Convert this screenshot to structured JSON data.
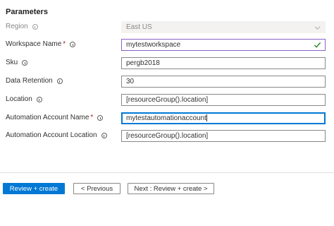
{
  "section": {
    "title": "Parameters"
  },
  "fields": {
    "region": {
      "label": "Region",
      "value": "East US"
    },
    "workspace_name": {
      "label": "Workspace Name",
      "required": "*",
      "value": "mytestworkspace"
    },
    "sku": {
      "label": "Sku",
      "value": "pergb2018"
    },
    "data_retention": {
      "label": "Data Retention",
      "value": "30"
    },
    "location": {
      "label": "Location",
      "value": "[resourceGroup().location]"
    },
    "automation_account_name": {
      "label": "Automation Account Name",
      "required": "*",
      "value": "mytestautomationaccount"
    },
    "automation_account_location": {
      "label": "Automation Account Location",
      "value": "[resourceGroup().location]"
    }
  },
  "buttons": {
    "review_create": "Review + create",
    "previous": "< Previous",
    "next": "Next : Review + create >"
  },
  "icons": {
    "info": "info-icon",
    "check": "checkmark-icon",
    "chevron": "chevron-down-icon"
  },
  "colors": {
    "primary": "#0078d4",
    "valid_check": "#107c10",
    "required": "#a4262c",
    "selected_border": "#8661c5"
  }
}
